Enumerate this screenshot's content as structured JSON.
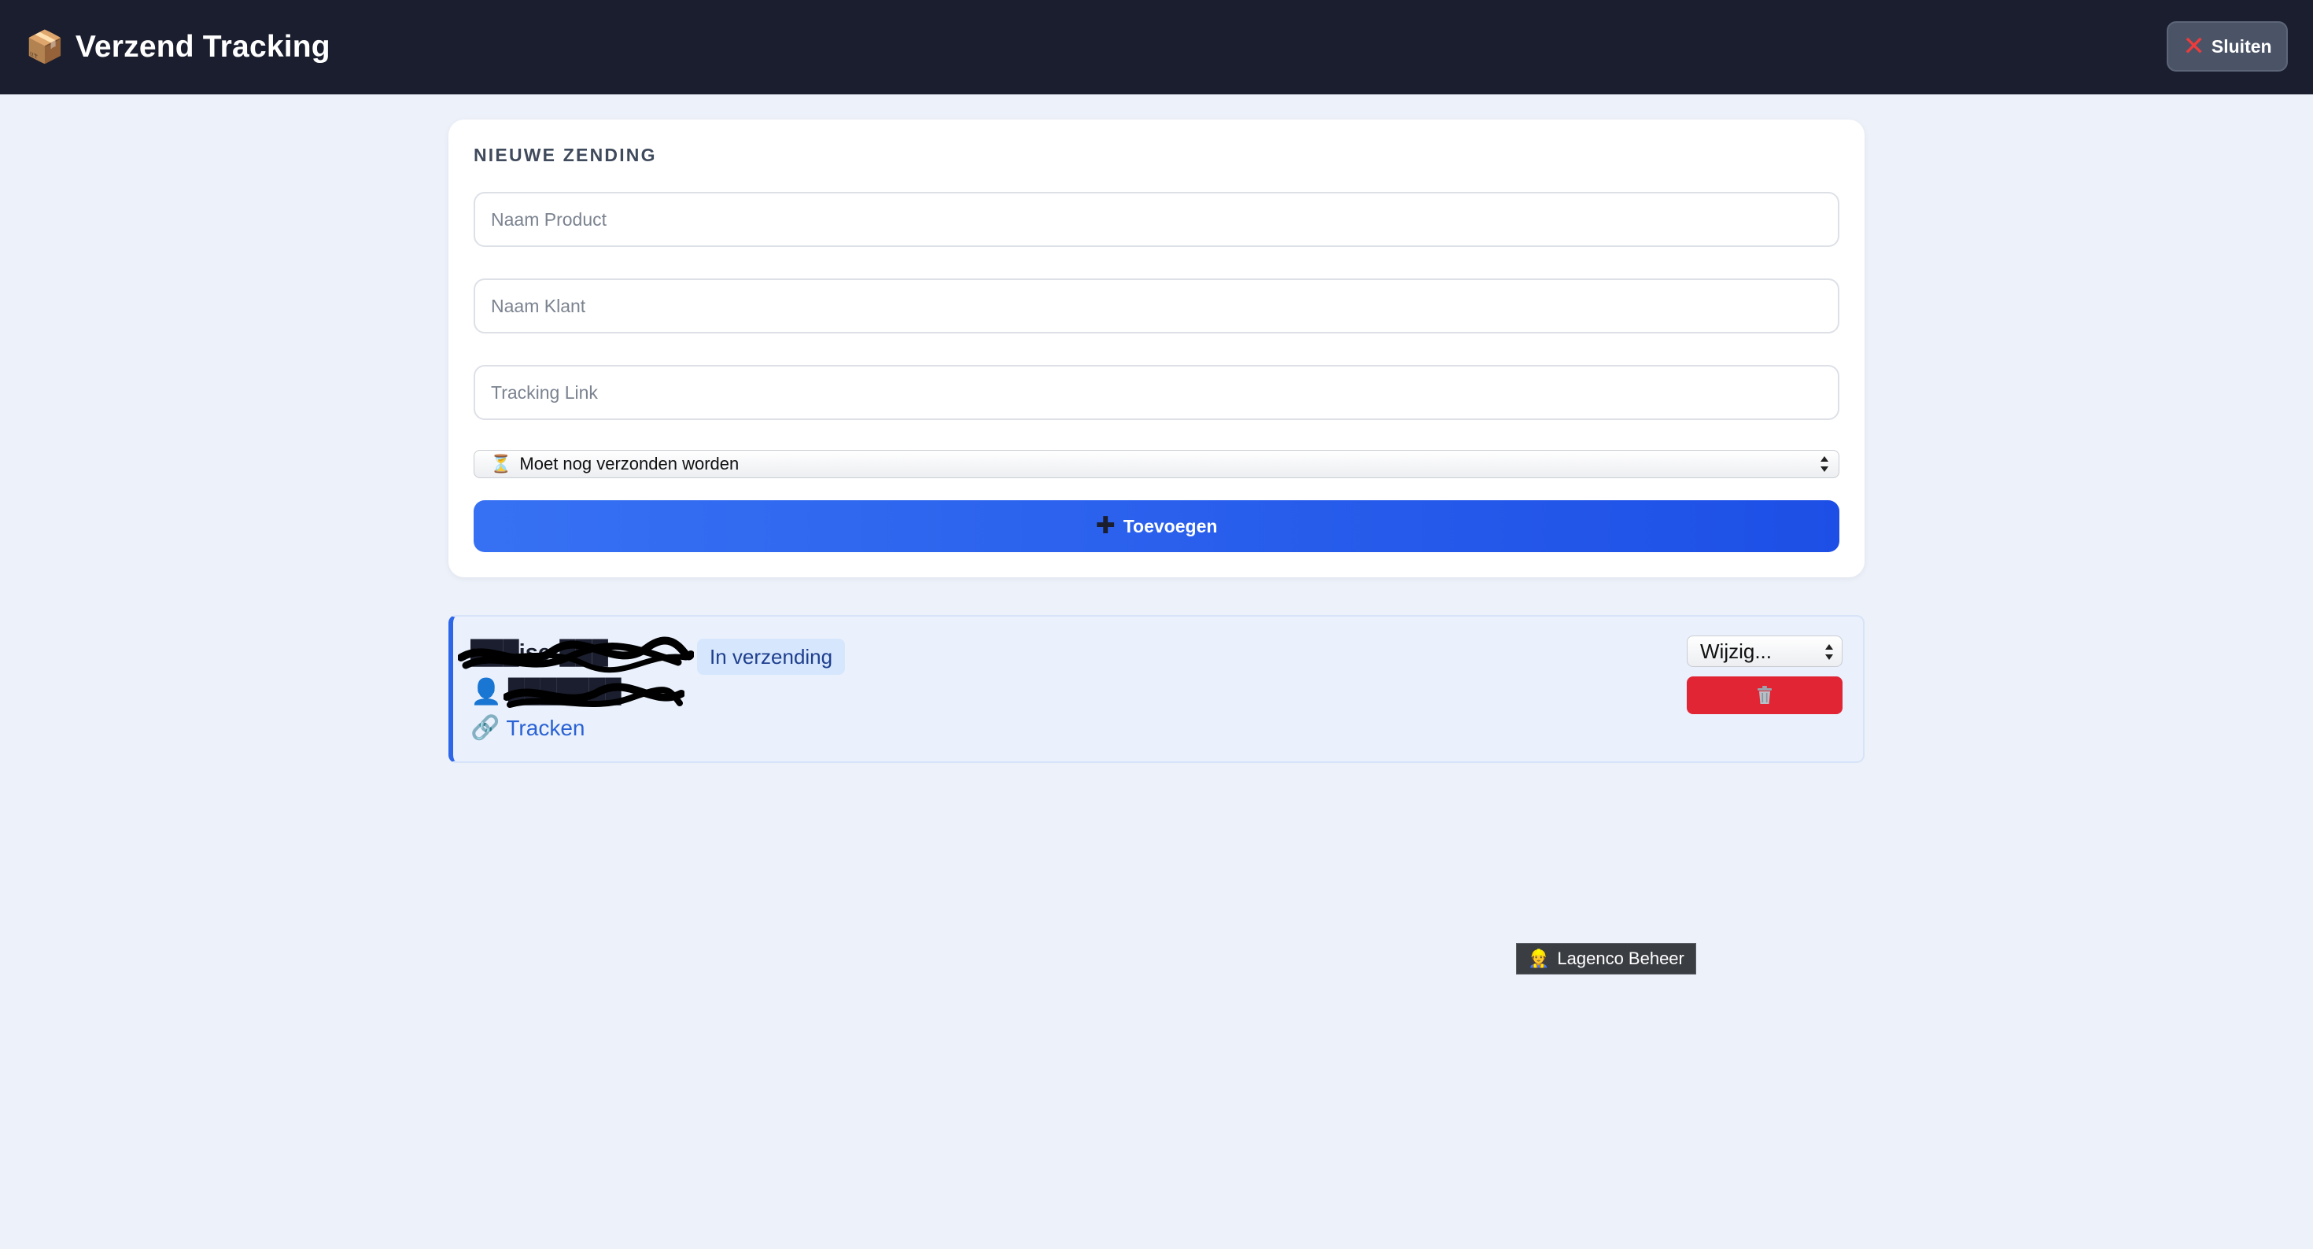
{
  "header": {
    "icon": "package-icon",
    "title": "Verzend Tracking",
    "close_icon": "x-icon",
    "close_label": "Sluiten"
  },
  "form": {
    "section_title": "NIEUWE ZENDING",
    "product_placeholder": "Naam Product",
    "customer_placeholder": "Naam Klant",
    "tracking_placeholder": "Tracking Link",
    "status_select": {
      "icon": "hourglass-icon",
      "selected": "Moet nog verzonden worden"
    },
    "add_button_label": "Toevoegen"
  },
  "shipments": [
    {
      "product": "███iser███",
      "status": "In verzending",
      "customer": "███████",
      "track_label": "Tracken",
      "change_select": "Wijzig...",
      "delete_icon": "trash-icon"
    }
  ],
  "tooltip": {
    "icon": "worker-icon",
    "text": "Lagenco Beheer"
  },
  "colors": {
    "topbar": "#1b1e2e",
    "accent": "#2d66e9",
    "danger": "#e12535",
    "background": "#edf1f9"
  }
}
